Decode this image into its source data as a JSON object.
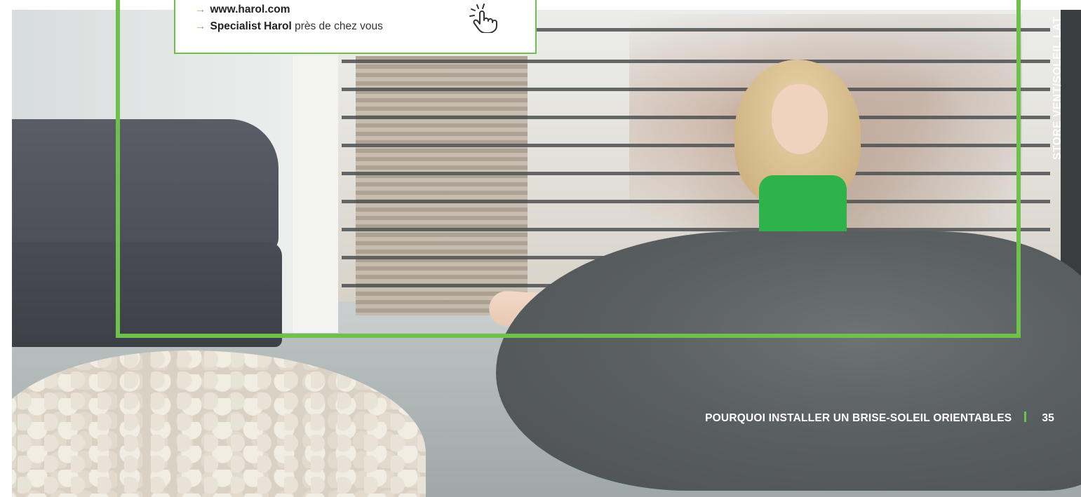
{
  "info_box": {
    "link_url": "www.harol.com",
    "specialist_bold": "Specialist Harol",
    "specialist_rest": " près de chez vous",
    "arrow": "→",
    "icon": "hand-pointer-icon"
  },
  "side_label": "STORE VENT/SOLEIL LAT",
  "footer": {
    "title": "POURQUOI INSTALLER UN BRISE-SOLEIL ORIENTABLES",
    "page_number": "35"
  },
  "colors": {
    "accent_green": "#6cc24a",
    "text_dark": "#333333",
    "white": "#ffffff"
  }
}
